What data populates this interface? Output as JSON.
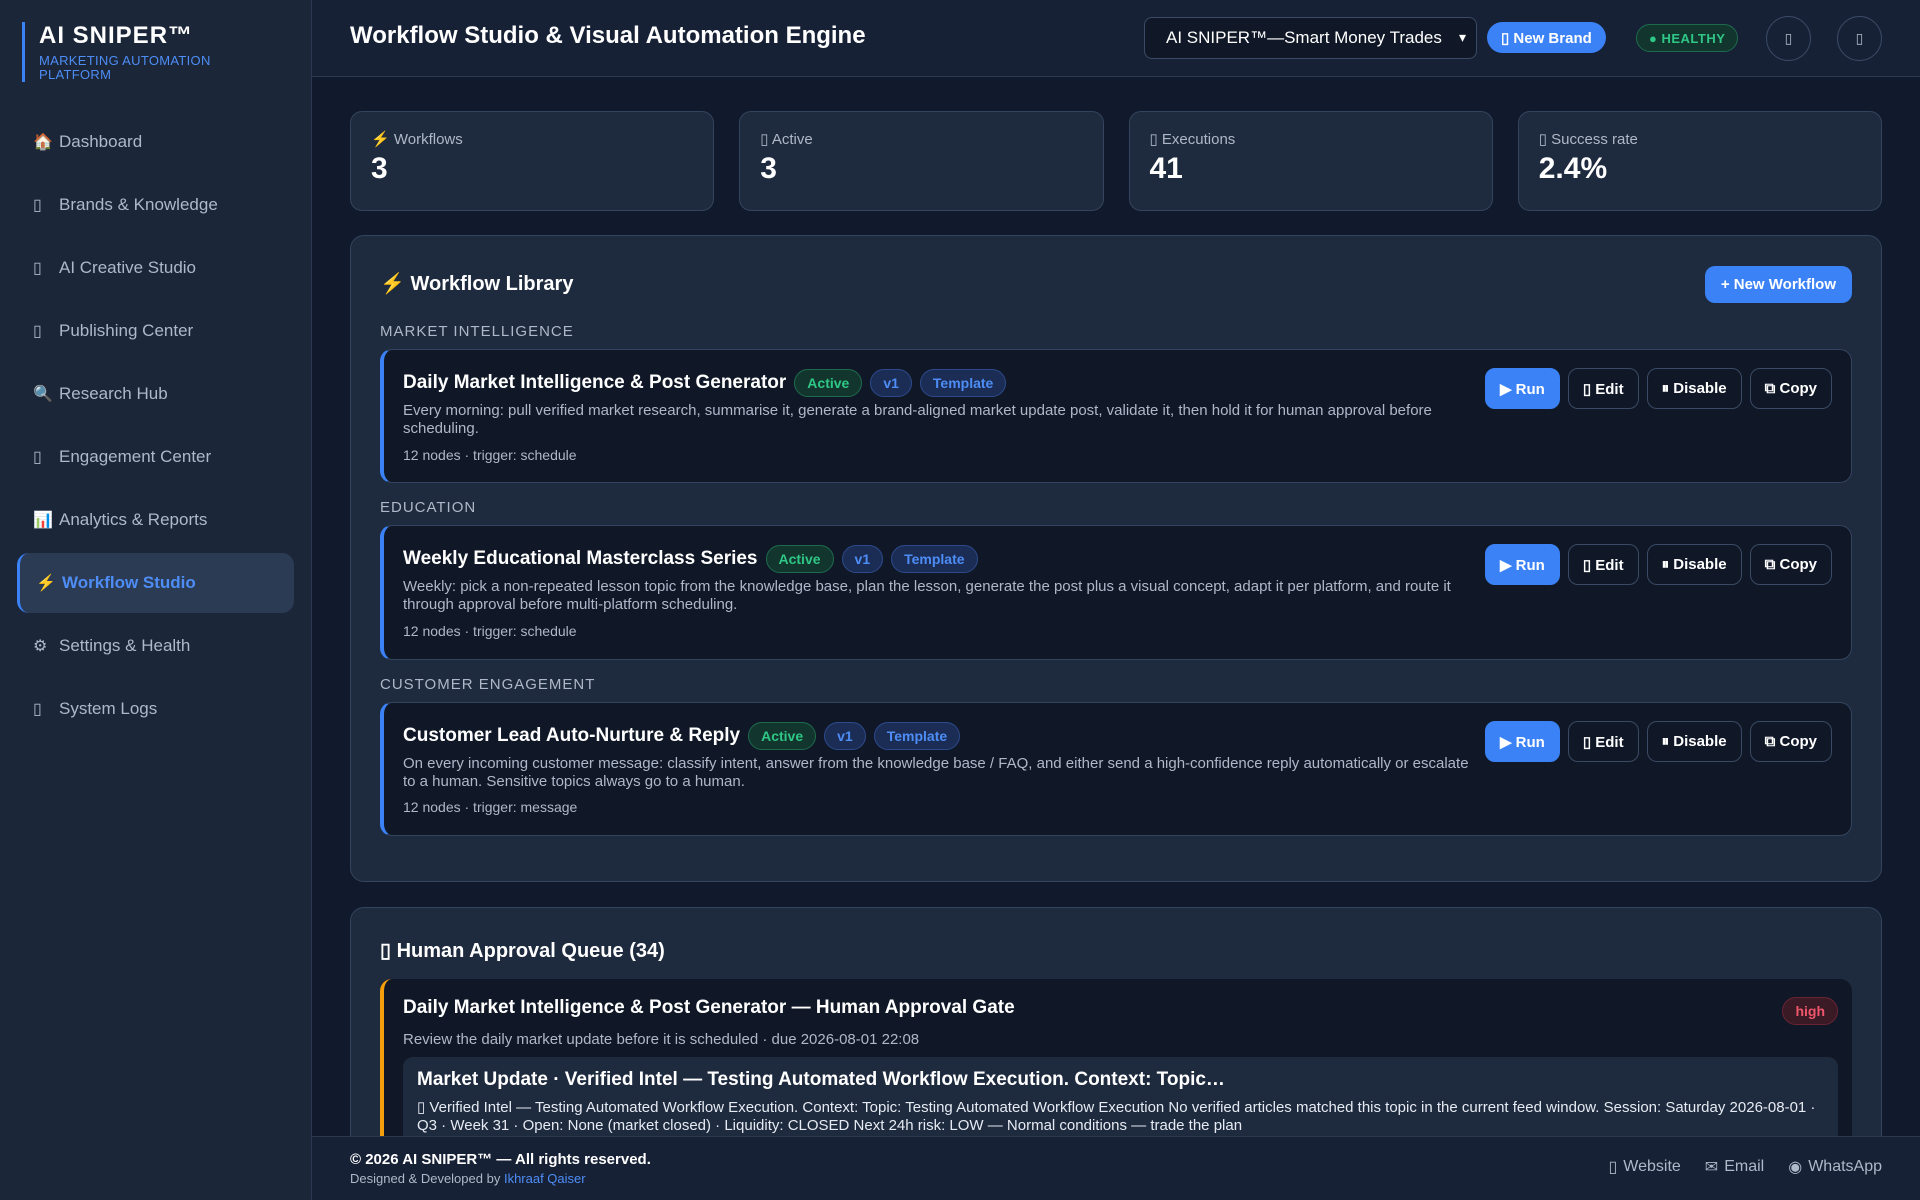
{
  "brand": {
    "title": "AI SNIPER™",
    "subtitle": "MARKETING AUTOMATION PLATFORM"
  },
  "sidebar": {
    "items": [
      {
        "label": "Dashboard",
        "icon": "🏠"
      },
      {
        "label": "Brands & Knowledge",
        "icon": "▯"
      },
      {
        "label": "AI Creative Studio",
        "icon": "▯"
      },
      {
        "label": "Publishing Center",
        "icon": "▯"
      },
      {
        "label": "Research Hub",
        "icon": "🔍"
      },
      {
        "label": "Engagement Center",
        "icon": "▯"
      },
      {
        "label": "Analytics & Reports",
        "icon": "📊"
      },
      {
        "label": "Workflow Studio",
        "icon": "⚡",
        "active": true
      },
      {
        "label": "Settings & Health",
        "icon": "⚙"
      },
      {
        "label": "System Logs",
        "icon": "▯"
      }
    ]
  },
  "header": {
    "title": "Workflow Studio & Visual Automation Engine",
    "brand_select": "AI SNIPER™—Smart Money Trades",
    "new_brand": "▯ New Brand",
    "health": "● HEALTHY"
  },
  "stats": [
    {
      "label": "⚡ Workflows",
      "value": "3"
    },
    {
      "label": "▯ Active",
      "value": "3"
    },
    {
      "label": "▯ Executions",
      "value": "41"
    },
    {
      "label": "▯ Success rate",
      "value": "2.4%"
    }
  ],
  "library": {
    "title": "⚡ Workflow Library",
    "new_workflow": "+ New Workflow",
    "buttons": {
      "run": "▶ Run",
      "edit": "▯ Edit",
      "disable": "⏸ Disable",
      "copy": "⧉ Copy"
    },
    "groups": [
      {
        "category": "MARKET INTELLIGENCE",
        "name": "Daily Market Intelligence & Post Generator",
        "status": "Active",
        "version": "v1",
        "tag": "Template",
        "description": "Every morning: pull verified market research, summarise it, generate a brand-aligned market update post, validate it, then hold it for human approval before scheduling.",
        "meta": "12 nodes · trigger: schedule"
      },
      {
        "category": "EDUCATION",
        "name": "Weekly Educational Masterclass Series",
        "status": "Active",
        "version": "v1",
        "tag": "Template",
        "description": "Weekly: pick a non-repeated lesson topic from the knowledge base, plan the lesson, generate the post plus a visual concept, adapt it per platform, and route it through approval before multi-platform scheduling.",
        "meta": "12 nodes · trigger: schedule"
      },
      {
        "category": "CUSTOMER ENGAGEMENT",
        "name": "Customer Lead Auto-Nurture & Reply",
        "status": "Active",
        "version": "v1",
        "tag": "Template",
        "description": "On every incoming customer message: classify intent, answer from the knowledge base / FAQ, and either send a high-confidence reply automatically or escalate to a human. Sensitive topics always go to a human.",
        "meta": "12 nodes · trigger: message"
      }
    ]
  },
  "approval": {
    "title": "▯ Human Approval Queue (34)",
    "item": {
      "title": "Daily Market Intelligence & Post Generator — Human Approval Gate",
      "subtitle": "Review the daily market update before it is scheduled · due 2026-08-01 22:08",
      "priority": "high",
      "post_title": "Market Update · Verified Intel — Testing Automated Workflow Execution. Context: Topic…",
      "post_body": "▯ Verified Intel — Testing Automated Workflow Execution. Context: Topic: Testing Automated Workflow Execution No verified articles matched this topic in the current feed window. Session: Saturday 2026-08-01 · Q3 · Week 31 · Open: None (market closed) · Liquidity: CLOSED Next 24h risk: LOW — Normal conditions — trade the plan"
    }
  },
  "footer": {
    "copyright": "© 2026 AI SNIPER™ — All rights reserved.",
    "credit_prefix": "Designed & Developed by",
    "credit_name": "Ikhraaf Qaiser",
    "links": [
      {
        "icon": "▯",
        "label": "Website"
      },
      {
        "icon": "✉",
        "label": "Email"
      },
      {
        "icon": "◉",
        "label": "WhatsApp"
      }
    ]
  }
}
